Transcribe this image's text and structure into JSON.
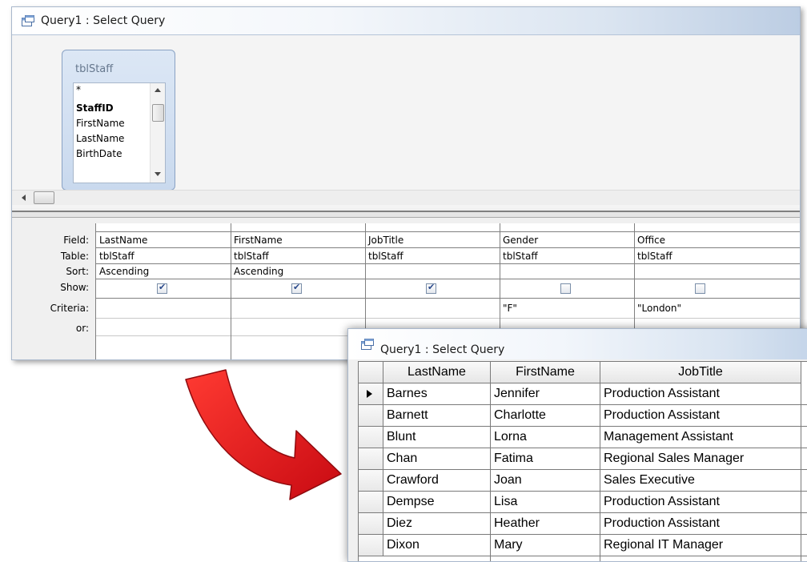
{
  "design_window": {
    "title": "Query1 : Select Query",
    "table": {
      "name": "tblStaff",
      "fields": [
        "*",
        "StaffID",
        "FirstName",
        "LastName",
        "BirthDate"
      ],
      "primary_key": "StaffID"
    },
    "row_labels": [
      "Field:",
      "Table:",
      "Sort:",
      "Show:",
      "Criteria:",
      "or:"
    ],
    "columns": [
      {
        "field": "LastName",
        "table": "tblStaff",
        "sort": "Ascending",
        "show": true,
        "criteria": ""
      },
      {
        "field": "FirstName",
        "table": "tblStaff",
        "sort": "Ascending",
        "show": true,
        "criteria": ""
      },
      {
        "field": "JobTitle",
        "table": "tblStaff",
        "sort": "",
        "show": true,
        "criteria": ""
      },
      {
        "field": "Gender",
        "table": "tblStaff",
        "sort": "",
        "show": false,
        "criteria": "\"F\""
      },
      {
        "field": "Office",
        "table": "tblStaff",
        "sort": "",
        "show": false,
        "criteria": "\"London\""
      }
    ]
  },
  "result_window": {
    "title": "Query1 : Select Query",
    "headers": [
      "LastName",
      "FirstName",
      "JobTitle"
    ],
    "rows": [
      [
        "Barnes",
        "Jennifer",
        "Production Assistant"
      ],
      [
        "Barnett",
        "Charlotte",
        "Production Assistant"
      ],
      [
        "Blunt",
        "Lorna",
        "Management Assistant"
      ],
      [
        "Chan",
        "Fatima",
        "Regional Sales Manager"
      ],
      [
        "Crawford",
        "Joan",
        "Sales Executive"
      ],
      [
        "Dempse",
        "Lisa",
        "Production Assistant"
      ],
      [
        "Diez",
        "Heather",
        "Production Assistant"
      ],
      [
        "Dixon",
        "Mary",
        "Regional IT Manager"
      ]
    ]
  },
  "icons": {
    "window": "query-window-icon",
    "arrow": "curved-arrow-icon",
    "record_pointer": "current-record-pointer-icon"
  },
  "colors": {
    "arrow_red": "#e8141c",
    "title_gradient_end": "#bccde3",
    "table_box": "#c9d9ee"
  }
}
